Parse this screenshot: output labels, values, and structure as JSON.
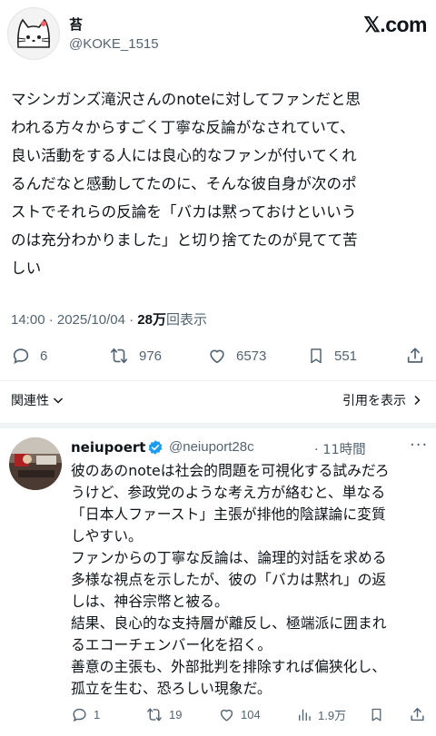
{
  "tweet": {
    "author_name": "苔",
    "author_handle": "@KOKE_1515",
    "brand": "𝕏.com",
    "text": "マシンガンズ滝沢さんのnoteに対してファンだと思\nわれる方々からすごく丁寧な反論がなされていて、\n良い活動をする人には良心的なファンが付いてくれ\nるんだなと感動してたのに、そんな彼自身が次のポ\nストでそれらの反論を「バカは黙っておけといいう\nのは充分わかりました」と切り捨てたのが見てて苦\nしい",
    "time": "14:00 · 2025/10/04 · ",
    "views_count": "28万",
    "views_label": "回表示",
    "counts": {
      "replies": "6",
      "retweets": "976",
      "likes": "6573",
      "bookmarks": "551"
    }
  },
  "nav": {
    "related": "関連性",
    "quotes": "引用を表示"
  },
  "reply": {
    "author_name": "neiupoert",
    "author_handle": "@neiuport28c",
    "time": "· 11時間",
    "more": "···",
    "text": "彼のあのnoteは社会的問題を可視化する試みだろ\nうけど、参政党のような考え方が絡むと、単なる\n「日本人ファースト」主張が排他的陰謀論に変質\nしやすい。\nファンからの丁寧な反論は、論理的対話を求める\n多様な視点を示したが、彼の「バカは黙れ」の返\nしは、神谷宗幣と被る。\n結果、良心的な支持層が離反し、極端派に囲まれ\nるエコーチェンバー化を招く。\n善意の主張も、外部批判を排除すれば偏狭化し、\n孤立を生む、恐ろしい現象だ。",
    "counts": {
      "replies": "1",
      "retweets": "19",
      "likes": "104",
      "views": "1.9万"
    }
  },
  "colors": {
    "text": "#0f1419",
    "secondary": "#536471",
    "verified": "#1d9bf0",
    "divider": "#eff3f4"
  },
  "icons": [
    "cat-avatar-icon",
    "reply-icon",
    "retweet-icon",
    "like-icon",
    "bookmark-icon",
    "share-icon",
    "chevron-down-icon",
    "chevron-right-icon",
    "verified-badge-icon",
    "views-icon"
  ]
}
